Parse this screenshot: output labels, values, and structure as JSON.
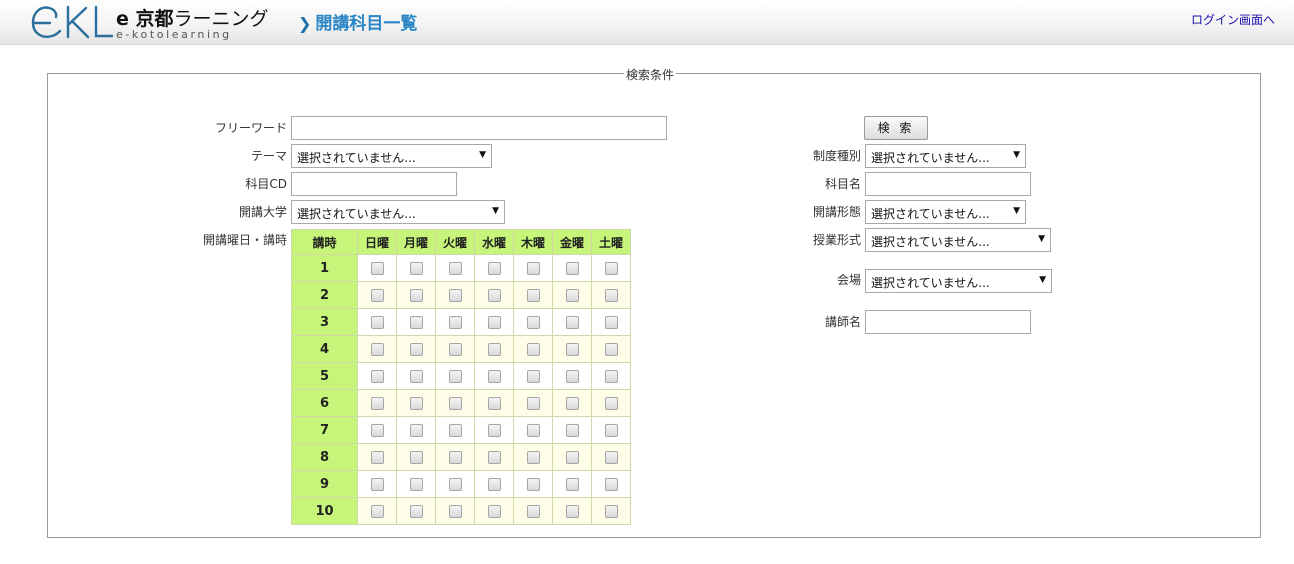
{
  "header": {
    "logo_title_bold": "e 京都",
    "logo_title_rest": "ラーニング",
    "logo_sub": "e-kotolearning",
    "page_title": "開講科目一覧",
    "login_link": "ログイン画面へ"
  },
  "search": {
    "legend": "検索条件",
    "search_button": "検 索",
    "left": {
      "freeword_label": "フリーワード",
      "freeword_value": "",
      "theme_label": "テーマ",
      "theme_value": "選択されていません...",
      "course_cd_label": "科目CD",
      "course_cd_value": "",
      "university_label": "開講大学",
      "university_value": "選択されていません...",
      "schedule_label": "開講曜日・講時"
    },
    "right": {
      "system_type_label": "制度種別",
      "system_type_value": "選択されていません...",
      "course_name_label": "科目名",
      "course_name_value": "",
      "form_label": "開講形態",
      "form_value": "選択されていません...",
      "class_format_label": "授業形式",
      "class_format_value": "選択されていません...",
      "venue_label": "会場",
      "venue_value": "選択されていません...",
      "lecturer_label": "講師名",
      "lecturer_value": ""
    }
  },
  "schedule": {
    "period_header": "講時",
    "days": [
      "日曜",
      "月曜",
      "火曜",
      "水曜",
      "木曜",
      "金曜",
      "土曜"
    ],
    "periods": [
      "1",
      "2",
      "3",
      "4",
      "5",
      "6",
      "7",
      "8",
      "9",
      "10"
    ]
  },
  "colors": {
    "grid_header_bg": "#c6f57a",
    "grid_alt_row_bg": "#fefee8",
    "title_blue": "#2a86c5",
    "link_color": "#1a0dab"
  }
}
